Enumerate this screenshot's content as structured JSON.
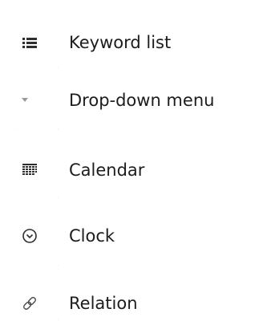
{
  "menu": {
    "items": [
      {
        "label": "Keyword list",
        "icon": "list-icon"
      },
      {
        "label": "Drop-down menu",
        "icon": "dropdown-arrow-icon"
      },
      {
        "label": "Calendar",
        "icon": "calendar-icon"
      },
      {
        "label": "Clock",
        "icon": "clock-icon"
      },
      {
        "label": "Relation",
        "icon": "link-icon"
      }
    ]
  },
  "colors": {
    "text": "#1c1c1c",
    "icon": "#2e2e2e",
    "background": "#ffffff"
  }
}
